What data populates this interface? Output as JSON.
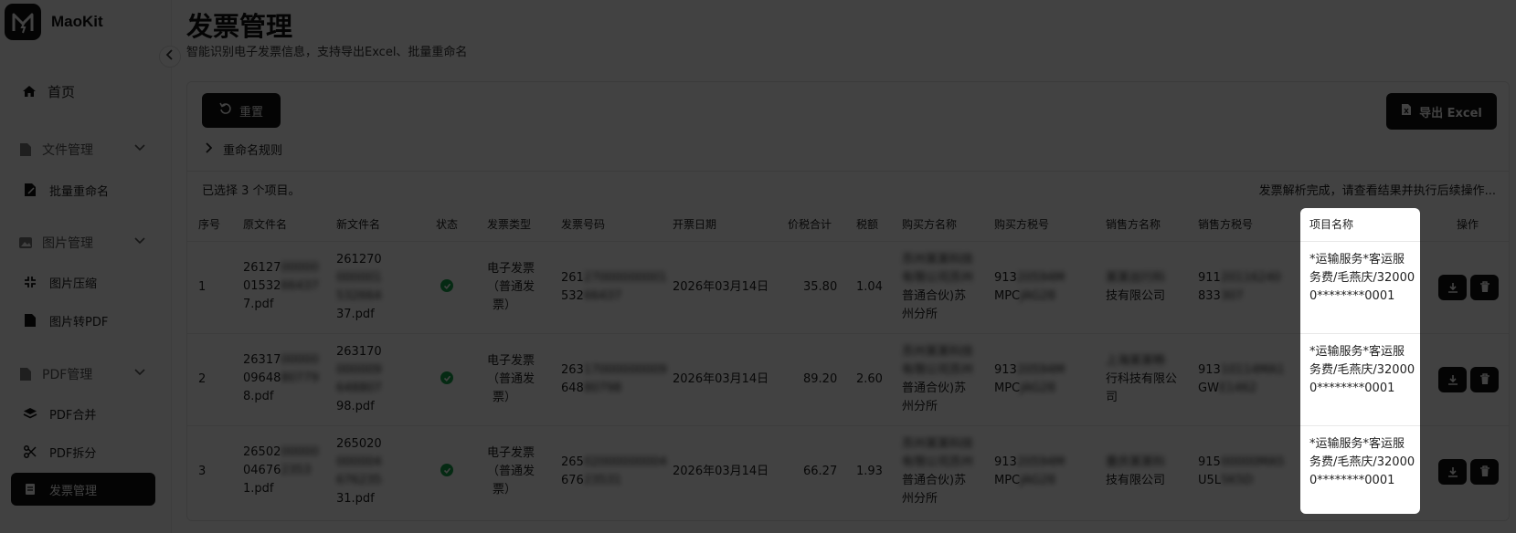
{
  "app": {
    "name": "MaoKit"
  },
  "nav": {
    "home": "首页",
    "groups": [
      {
        "label": "文件管理",
        "items": [
          "批量重命名"
        ]
      },
      {
        "label": "图片管理",
        "items": [
          "图片压缩",
          "图片转PDF"
        ]
      },
      {
        "label": "PDF管理",
        "items": [
          "PDF合并",
          "PDF拆分",
          "发票管理"
        ]
      }
    ],
    "active": "发票管理"
  },
  "page": {
    "title": "发票管理",
    "subtitle": "智能识别电子发票信息，支持导出Excel、批量重命名"
  },
  "toolbar": {
    "reset_label": "重置",
    "export_label": "导出 Excel",
    "rule_label": "重命名规则"
  },
  "summary": {
    "selected": "已选择 3 个项目。",
    "status": "发票解析完成，请查看结果并执行后续操作..."
  },
  "table": {
    "headers": [
      "序号",
      "原文件名",
      "新文件名",
      "状态",
      "发票类型",
      "发票号码",
      "开票日期",
      "价税合计",
      "税额",
      "购买方名称",
      "购买方税号",
      "销售方名称",
      "销售方税号",
      "项目名称",
      "操作"
    ],
    "rows": [
      {
        "index": "1",
        "orig_a": "26127",
        "orig_a_blur": "00000",
        "orig_b": "01532",
        "orig_b_blur": "66437",
        "orig_c": "7.pdf",
        "new_a": "261270",
        "new_b_blur": "000001",
        "new_c_blur": "532664",
        "new_d": "37.pdf",
        "type": [
          "电子发票",
          "（普通发",
          "票）"
        ],
        "num_a": "261",
        "num_a_blur": "27000000001",
        "num_b": "532",
        "num_b_blur": "66437",
        "date": "2026年03月14日",
        "total": "35.80",
        "tax": "1.04",
        "buyer_blur": [
          "苏州某某科技",
          "有限公司苏州"
        ],
        "buyer_clear": [
          "普通合伙)苏",
          "州分所"
        ],
        "buyer_tax_a": "913",
        "buyer_tax_a_blur": "20594M",
        "buyer_tax_b": "MPC",
        "buyer_tax_b_blur": "JAG28",
        "seller_blur": "某某出行科",
        "seller_clear": "技有限公司",
        "seller_tax_a": "911",
        "seller_tax_a_blur": "20116240",
        "seller_tax_b": "833",
        "seller_tax_b_blur": "307",
        "item": "*运输服务*客运服务费/毛燕庆/320000********0001"
      },
      {
        "index": "2",
        "orig_a": "26317",
        "orig_a_blur": "00000",
        "orig_b": "09648",
        "orig_b_blur": "80779",
        "orig_c": "8.pdf",
        "new_a": "263170",
        "new_b_blur": "000009",
        "new_c_blur": "648807",
        "new_d": "98.pdf",
        "type": [
          "电子发票",
          "（普通发",
          "票）"
        ],
        "num_a": "263",
        "num_a_blur": "17000000009",
        "num_b": "648",
        "num_b_blur": "80798",
        "date": "2026年03月14日",
        "total": "89.20",
        "tax": "2.60",
        "buyer_blur": [
          "苏州某某科技",
          "有限公司苏州"
        ],
        "buyer_clear": [
          "普通合伙)苏",
          "州分所"
        ],
        "buyer_tax_a": "913",
        "buyer_tax_a_blur": "20594M",
        "buyer_tax_b": "MPC",
        "buyer_tax_b_blur": "JAG28",
        "seller_blur": "上海某某畅",
        "seller_clear": "行科技有限公司",
        "seller_tax_a": "913",
        "seller_tax_a_blur": "10114MA1",
        "seller_tax_b": "GW",
        "seller_tax_b_blur": "E1462",
        "item": "*运输服务*客运服务费/毛燕庆/320000********0001"
      },
      {
        "index": "3",
        "orig_a": "26502",
        "orig_a_blur": "00000",
        "orig_b": "04676",
        "orig_b_blur": "2353",
        "orig_c": "1.pdf",
        "new_a": "265020",
        "new_b_blur": "000004",
        "new_c_blur": "676235",
        "new_d": "31.pdf",
        "type": [
          "电子发票",
          "（普通发",
          "票）"
        ],
        "num_a": "265",
        "num_a_blur": "02000000004",
        "num_b": "676",
        "num_b_blur": "23531",
        "date": "2026年03月14日",
        "total": "66.27",
        "tax": "1.93",
        "buyer_blur": [
          "苏州某某科技",
          "有限公司苏州"
        ],
        "buyer_clear": [
          "普通合伙)苏",
          "州分所"
        ],
        "buyer_tax_a": "913",
        "buyer_tax_a_blur": "20594M",
        "buyer_tax_b": "MPC",
        "buyer_tax_b_blur": "JAG28",
        "seller_blur": "重庆某某科",
        "seller_clear": "技有限公司",
        "seller_tax_a": "915",
        "seller_tax_a_blur": "00000MA5",
        "seller_tax_b": "U5L",
        "seller_tax_b_blur": "5K5D",
        "item": "*运输服务*客运服务费/毛燕庆/320000********0001"
      }
    ]
  },
  "colors": {
    "accent": "#111111",
    "success": "#16a34a"
  }
}
